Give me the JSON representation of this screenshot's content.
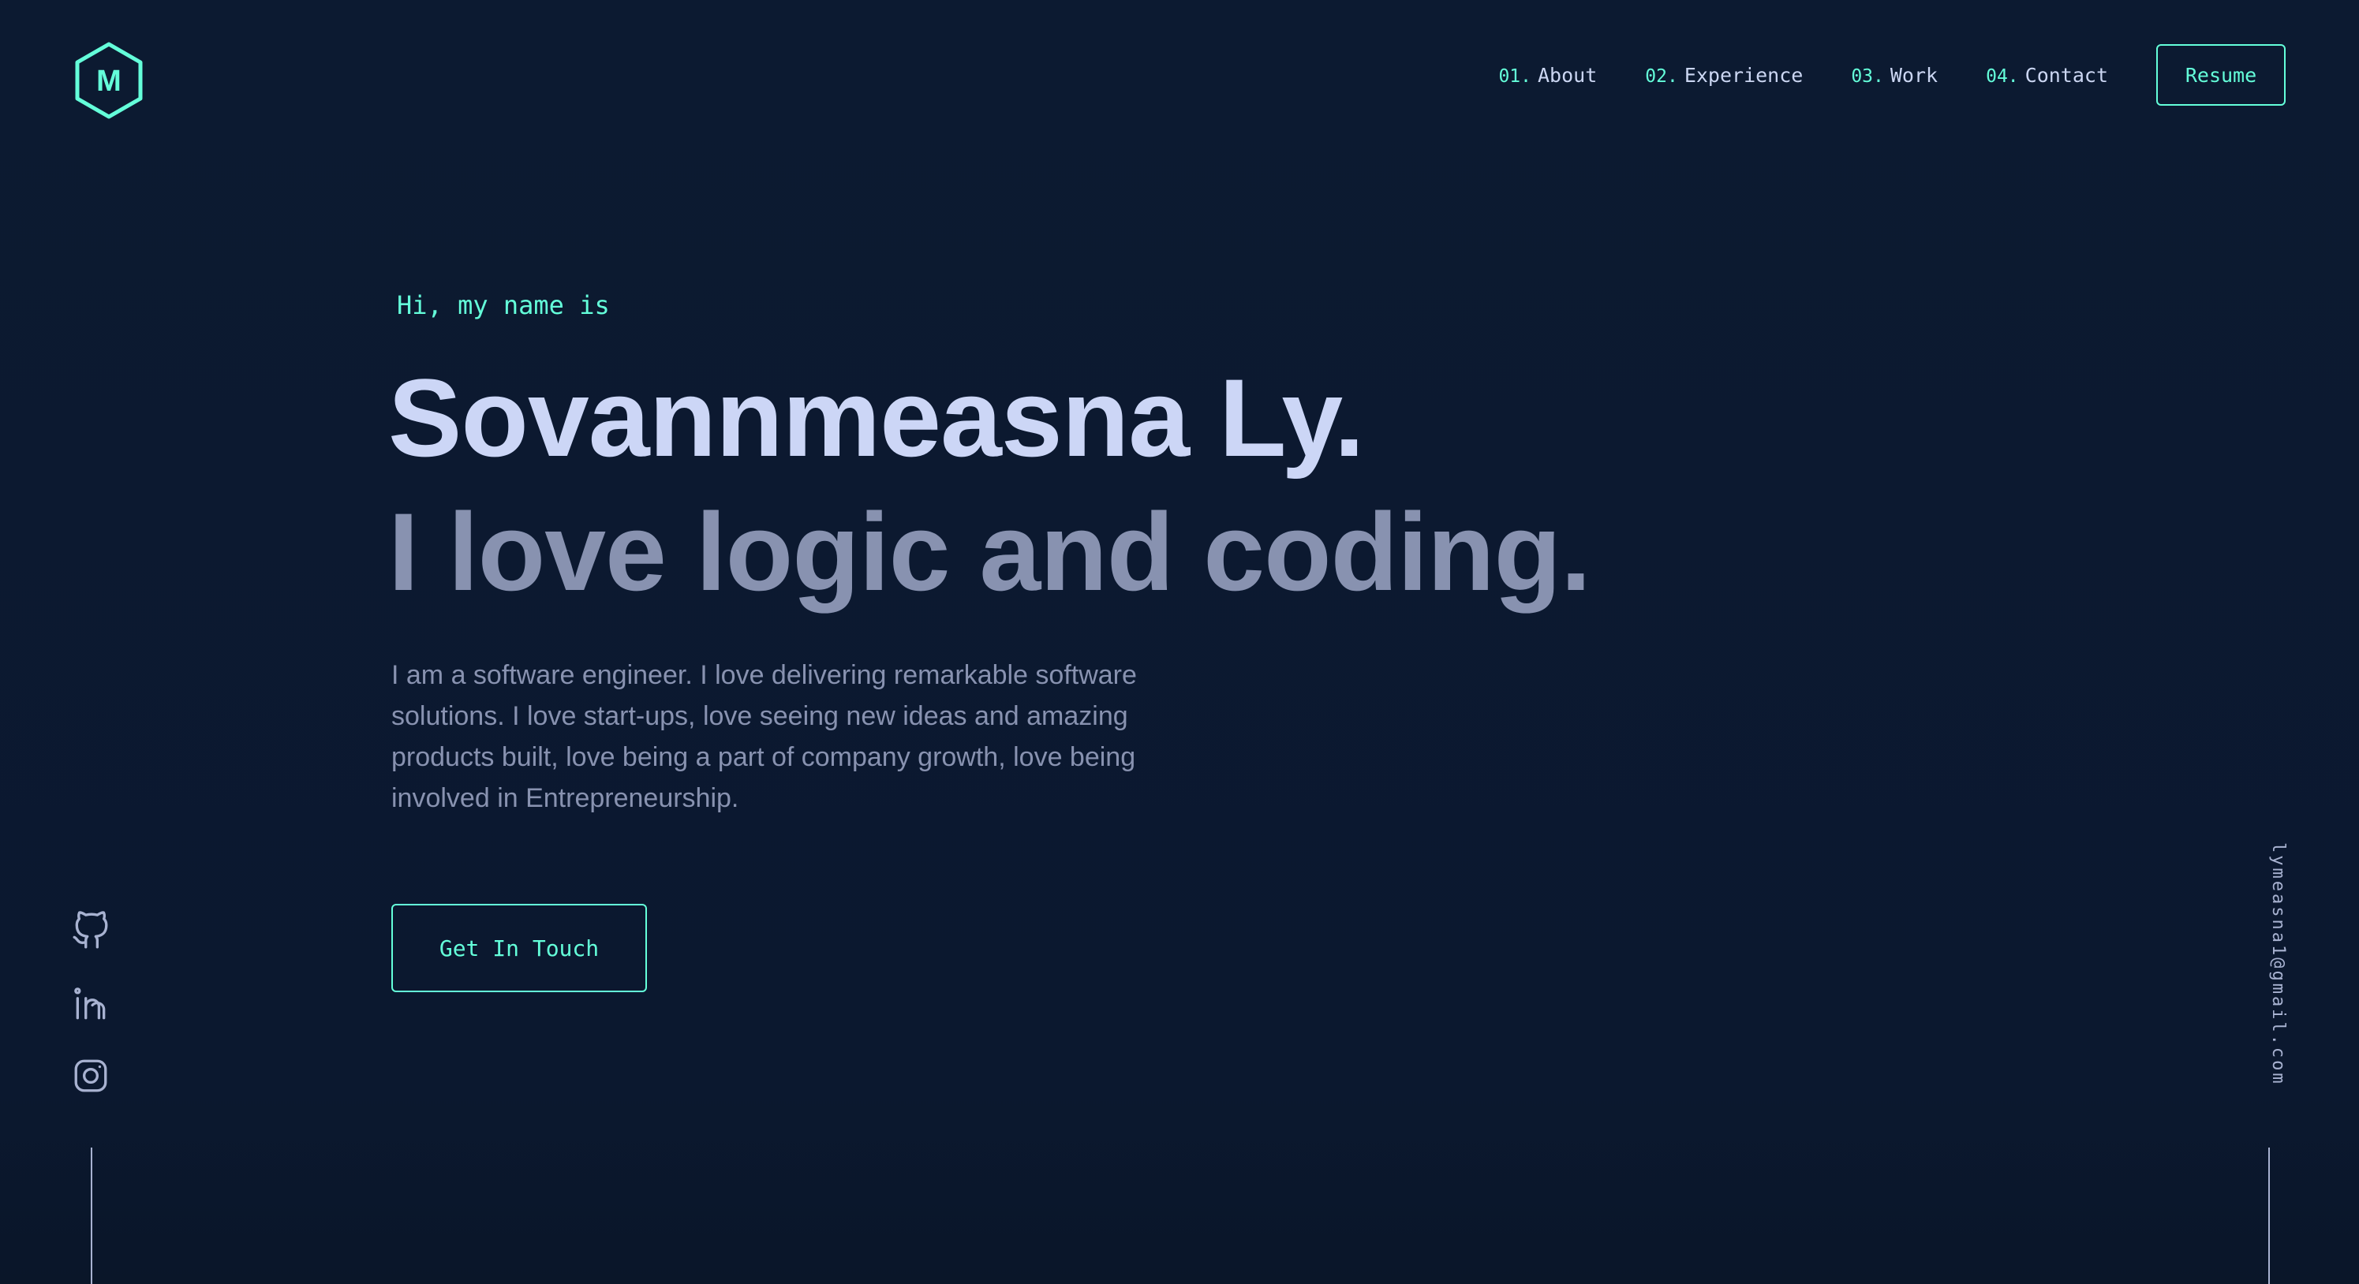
{
  "colors": {
    "background": "#0b182f",
    "accent": "#64ffda",
    "heading": "#ccd6f6",
    "muted": "#8892b0"
  },
  "header": {
    "logo_letter": "M",
    "nav": [
      {
        "number": "01.",
        "label": "About"
      },
      {
        "number": "02.",
        "label": "Experience"
      },
      {
        "number": "03.",
        "label": "Work"
      },
      {
        "number": "04.",
        "label": "Contact"
      }
    ],
    "resume_label": "Resume"
  },
  "hero": {
    "intro": "Hi, my name is",
    "name": "Sovannmeasna Ly.",
    "tagline": "I love logic and coding.",
    "bio": "I am a software engineer. I love delivering remarkable software solutions. I love start-ups, love seeing new ideas and amazing products built, love being a part of company growth, love being involved in Entrepreneurship.",
    "cta_label": "Get In Touch"
  },
  "socials": [
    {
      "icon": "github-icon"
    },
    {
      "icon": "linkedin-icon"
    },
    {
      "icon": "instagram-icon"
    }
  ],
  "email": "lymeasna1@gmail.com"
}
